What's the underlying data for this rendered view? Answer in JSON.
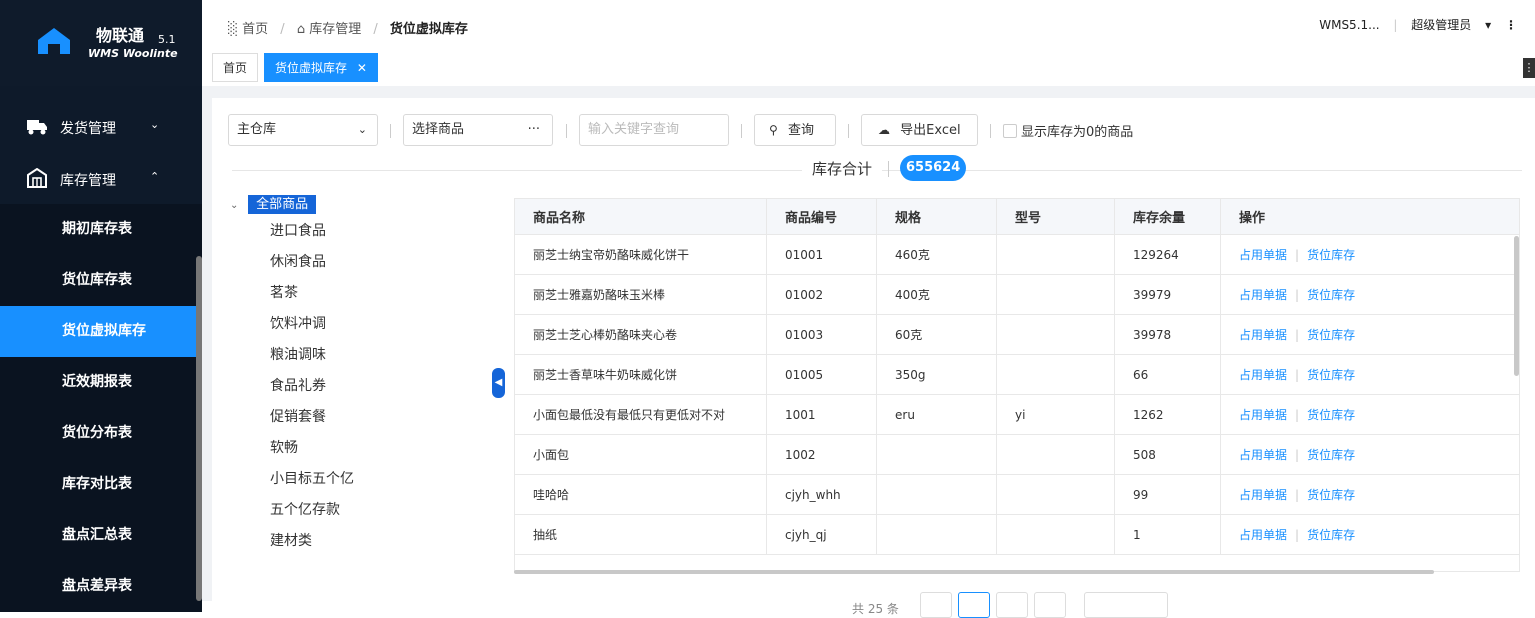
{
  "app": {
    "title": "物联通",
    "version": "5.1",
    "subtitle": "WMS Woolinte"
  },
  "colors": {
    "accent": "#1890ff",
    "sidebar": "#0e1a2a",
    "badge": "#1565d8"
  },
  "sidebar": {
    "groups": [
      {
        "label": "发货管理",
        "icon": "truck-icon",
        "expanded": false
      },
      {
        "label": "库存管理",
        "icon": "warehouse-icon",
        "expanded": true
      }
    ],
    "items": [
      "期初库存表",
      "货位库存表",
      "货位虚拟库存",
      "近效期报表",
      "货位分布表",
      "库存对比表",
      "盘点汇总表",
      "盘点差异表"
    ],
    "active_index": 2
  },
  "breadcrumb": {
    "home": "首页",
    "section": "库存管理",
    "current": "货位虚拟库存"
  },
  "topright": {
    "version": "WMS5.1...",
    "user": "超级管理员"
  },
  "tabs": {
    "home": "首页",
    "current": "货位虚拟库存"
  },
  "filters": {
    "warehouse": "主仓库",
    "product_placeholder": "选择商品",
    "product_more": "···",
    "keyword_placeholder": "输入关键字查询",
    "query": "查询",
    "export": "导出Excel",
    "show_zero": "显示库存为0的商品"
  },
  "summary": {
    "label": "库存合计",
    "total": "655624"
  },
  "tree": {
    "root": "全部商品",
    "children": [
      "进口食品",
      "休闲食品",
      "茗茶",
      "饮料冲调",
      "粮油调味",
      "食品礼券",
      "促销套餐",
      "软畅",
      "小目标五个亿",
      "五个亿存款",
      "建材类"
    ]
  },
  "table": {
    "columns": [
      "商品名称",
      "商品编号",
      "规格",
      "型号",
      "库存余量",
      "操作"
    ],
    "rows": [
      [
        "丽芝士纳宝帝奶酪味威化饼干",
        "01001",
        "460克",
        "",
        "129264"
      ],
      [
        "丽芝士雅嘉奶酪味玉米棒",
        "01002",
        "400克",
        "",
        "39979"
      ],
      [
        "丽芝士芝心棒奶酪味夹心卷",
        "01003",
        "60克",
        "",
        "39978"
      ],
      [
        "丽芝士香草味牛奶味威化饼",
        "01005",
        "350g",
        "",
        "66"
      ],
      [
        "小面包最低没有最低只有更低对不对",
        "1001",
        "eru",
        "yi",
        "1262"
      ],
      [
        "小面包",
        "1002",
        "",
        "",
        "508"
      ],
      [
        "哇哈哈",
        "cjyh_whh",
        "",
        "",
        "99"
      ],
      [
        "抽纸",
        "cjyh_qj",
        "",
        "",
        "1"
      ]
    ],
    "action1": "占用单据",
    "action2": "货位库存"
  },
  "pager": {
    "total_prefix": "共 25 条"
  }
}
